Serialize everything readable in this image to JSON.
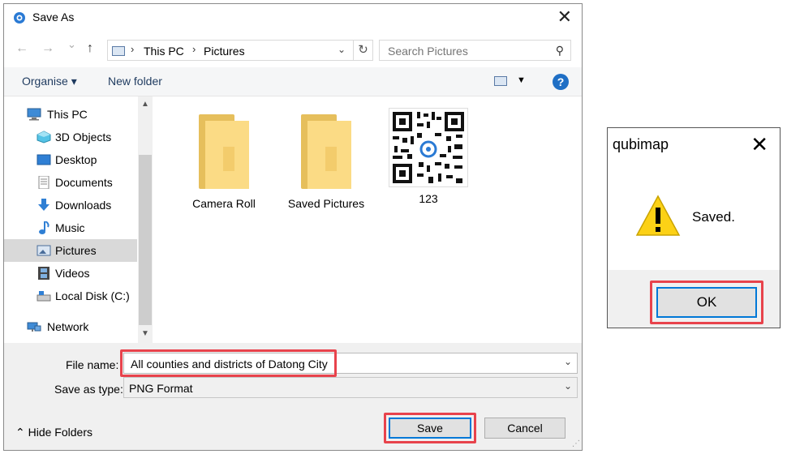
{
  "save_dialog": {
    "title": "Save As",
    "close_glyph": "✕",
    "nav": {
      "back": "←",
      "forward": "→",
      "recent": "⌄",
      "up": "↑"
    },
    "address": {
      "segments": [
        "This PC",
        "Pictures"
      ],
      "separator": "›",
      "dropdown": "⌄",
      "refresh": "↻"
    },
    "search": {
      "placeholder": "Search Pictures",
      "icon": "search-icon",
      "glyph": "⚲"
    },
    "toolbar": {
      "organise": "Organise ▾",
      "new_folder": "New folder",
      "view_dropdown": "▼",
      "help": "?"
    },
    "sidebar": {
      "items": [
        {
          "label": "This PC",
          "icon": "computer-icon"
        },
        {
          "label": "3D Objects",
          "icon": "cube-icon"
        },
        {
          "label": "Desktop",
          "icon": "desktop-icon"
        },
        {
          "label": "Documents",
          "icon": "document-icon"
        },
        {
          "label": "Downloads",
          "icon": "download-arrow-icon"
        },
        {
          "label": "Music",
          "icon": "music-note-icon"
        },
        {
          "label": "Pictures",
          "icon": "pictures-icon",
          "selected": true
        },
        {
          "label": "Videos",
          "icon": "film-icon"
        },
        {
          "label": "Local Disk (C:)",
          "icon": "disk-icon"
        },
        {
          "label": "Network",
          "icon": "network-icon"
        }
      ],
      "scroll_up": "▲",
      "scroll_down": "▼"
    },
    "files": [
      {
        "label": "Camera Roll",
        "type": "folder"
      },
      {
        "label": "Saved Pictures",
        "type": "folder"
      },
      {
        "label": "123",
        "type": "image"
      }
    ],
    "file_name": {
      "label": "File name:",
      "value": "All counties and districts of Datong City",
      "dropdown": "⌄"
    },
    "save_type": {
      "label": "Save as type:",
      "value": "PNG Format",
      "dropdown": "⌄"
    },
    "hide_folders": "⌃  Hide Folders",
    "save_button": "Save",
    "cancel_button": "Cancel",
    "highlight_color": "#e8434c",
    "accent_color": "#0078d7"
  },
  "message_box": {
    "title": "qubimap",
    "close_glyph": "✕",
    "icon": "warning-icon",
    "message": "Saved.",
    "ok_button": "OK"
  }
}
